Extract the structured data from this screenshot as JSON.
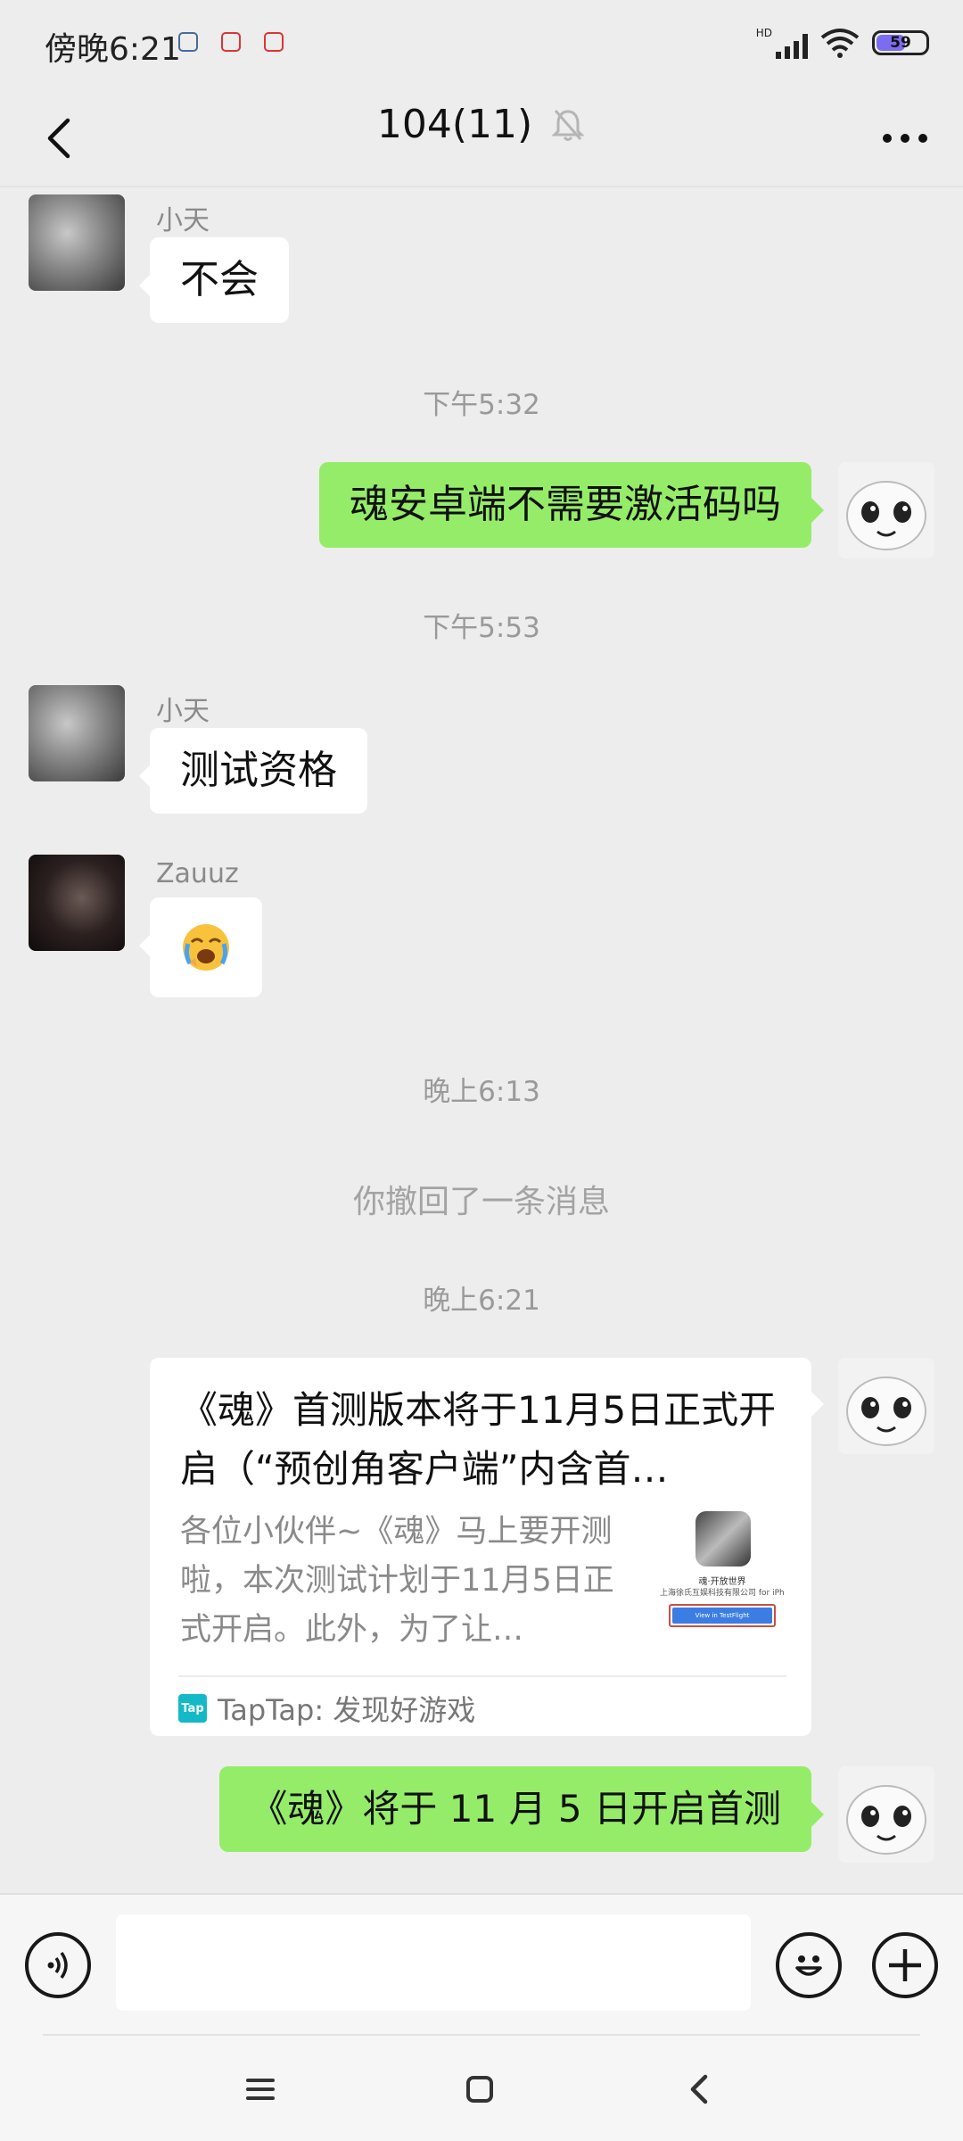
{
  "status_bar": {
    "time": "傍晚6:21",
    "signal_label": "HD",
    "battery_level": "59",
    "battery_fraction": 0.59
  },
  "header": {
    "back_icon": "chevron-left-icon",
    "title": "104(11)",
    "mute_icon": "bell-off-icon",
    "more_icon": "more-dots-icon"
  },
  "messages": [
    {
      "sender": "小天",
      "text": "不会",
      "direction": "in"
    },
    {
      "type": "time",
      "text": "下午5:32"
    },
    {
      "text": "魂安卓端不需要激活码吗",
      "direction": "out"
    },
    {
      "type": "time",
      "text": "下午5:53"
    },
    {
      "sender": "小天",
      "text": "测试资格",
      "direction": "in"
    },
    {
      "sender": "Zauuz",
      "text": "😭",
      "direction": "in"
    },
    {
      "type": "time",
      "text": "晚上6:13"
    },
    {
      "type": "recall",
      "text": "你撤回了一条消息"
    },
    {
      "type": "time",
      "text": "晚上6:21"
    },
    {
      "type": "link_card",
      "direction": "out",
      "title": "《魂》首测版本将于11月5日正式开启（“预创角客户端”内含首…",
      "description": "各位小伙伴~《魂》马上要开测啦，本次测试计划于11月5日正式开启。此外，为了让…",
      "thumb_title": "魂·开放世界",
      "thumb_company": "上海徐氏互娱科技有限公司 for iPhone",
      "thumb_button": "View in TestFlight",
      "source": "TapTap: 发现好游戏",
      "source_logo": "Tap"
    },
    {
      "text": "《魂》将于 11 月 5 日开启首测",
      "direction": "out"
    }
  ],
  "input_bar": {
    "voice_icon": "voice-icon",
    "value": "",
    "emoji_icon": "emoji-icon",
    "plus_icon": "plus-icon"
  },
  "system_nav": {
    "menu_icon": "menu-icon",
    "home_icon": "home-icon",
    "back_icon": "back-triangle-icon"
  },
  "colors": {
    "background": "#ededed",
    "outgoing_bubble": "#95ec69",
    "incoming_bubble": "#ffffff",
    "battery_fill": "#7b6cf0",
    "taptap": "#14b9c8"
  }
}
